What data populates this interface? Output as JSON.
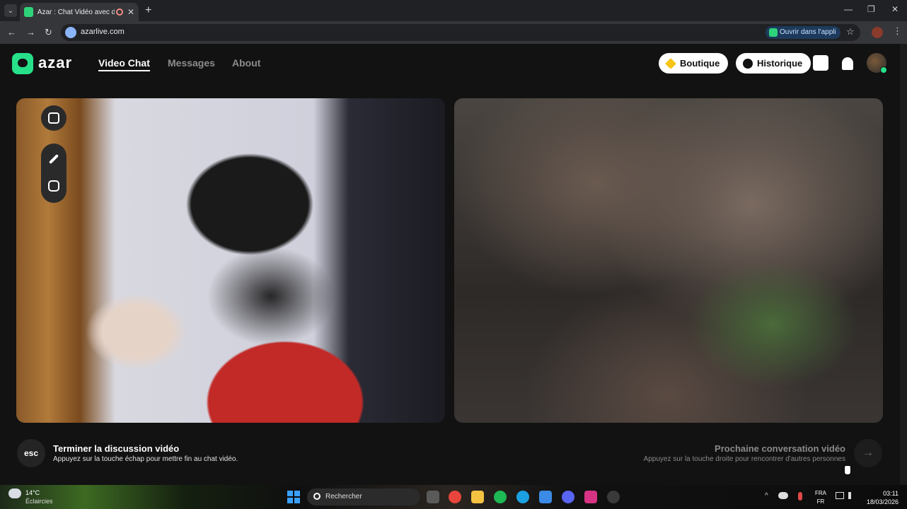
{
  "browser": {
    "tab_title": "Azar : Chat Vidéo avec de n",
    "tab_close": "✕",
    "new_tab": "+",
    "url": "azarlive.com",
    "open_app_label": "Ouvrir dans l'appli",
    "window_controls": {
      "minimize": "—",
      "restore": "❐",
      "close": "✕"
    },
    "nav": {
      "back": "←",
      "forward": "→",
      "reload": "↻",
      "star": "☆",
      "menu": "⋮",
      "tab_menu": "⌄"
    }
  },
  "header": {
    "logo_text": "azar",
    "nav": [
      {
        "label": "Video Chat",
        "active": true
      },
      {
        "label": "Messages",
        "active": false
      },
      {
        "label": "About",
        "active": false
      }
    ],
    "boutique_label": "Boutique",
    "historique_label": "Historique"
  },
  "video": {
    "left_controls": [
      "shrink-icon",
      "magic-wand-icon",
      "smiley-icon"
    ]
  },
  "actions": {
    "esc_key": "esc",
    "end_title": "Terminer la discussion vidéo",
    "end_hint": "Appuyez sur la touche échap pour mettre fin au chat vidéo.",
    "next_title": "Prochaine conversation vidéo",
    "next_hint": "Appuyez sur la touche droite pour rencontrer d'autres personnes",
    "next_arrow": "→"
  },
  "taskbar": {
    "temperature": "14°C",
    "condition": "Éclaircies",
    "search_label": "Rechercher",
    "language_line1": "FRA",
    "language_line2": "FR",
    "time": "03:11",
    "date": "18/03/2026",
    "tray_chevron": "^"
  },
  "colors": {
    "brand": "#27e08a",
    "boutique_gem": "#f7c517"
  }
}
